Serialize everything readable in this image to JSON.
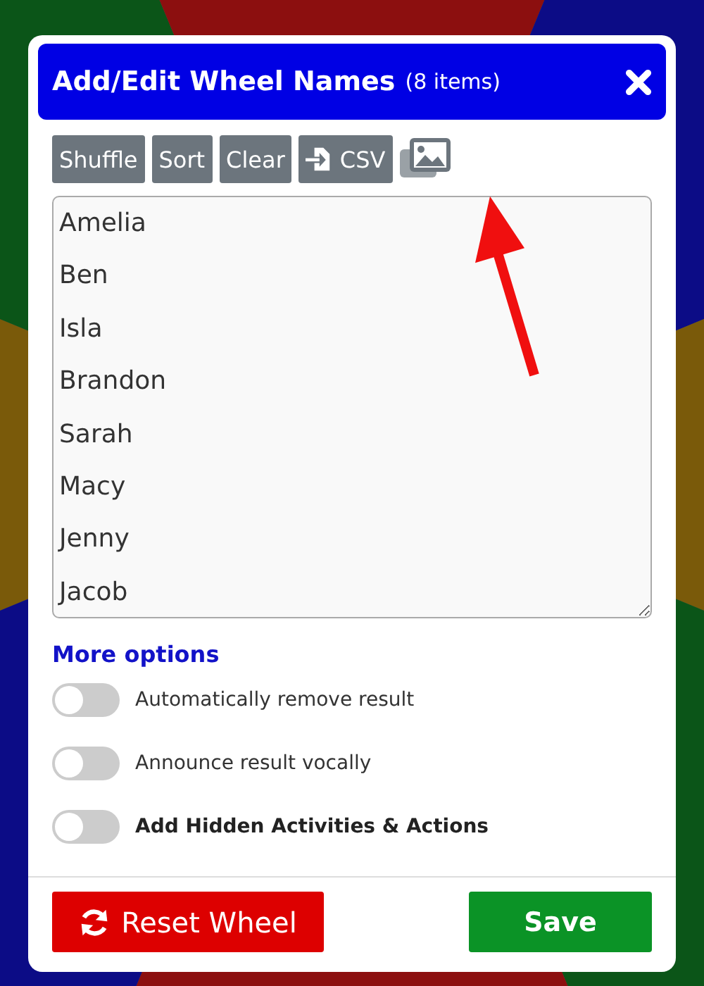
{
  "dialog": {
    "title": "Add/Edit Wheel Names",
    "count": "(8 items)"
  },
  "toolbar": [
    {
      "kind": "text",
      "label": "Shuffle"
    },
    {
      "kind": "text",
      "label": "Sort"
    },
    {
      "kind": "text",
      "label": "Clear"
    },
    {
      "kind": "import",
      "label": "CSV"
    },
    {
      "kind": "image"
    }
  ],
  "names": [
    "Amelia",
    "Ben",
    "Isla",
    "Brandon",
    "Sarah",
    "Macy",
    "Jenny",
    "Jacob"
  ],
  "more_options": "More options",
  "toggles": [
    {
      "label": "Automatically remove result",
      "on": false,
      "emphasis": false
    },
    {
      "label": "Announce result vocally",
      "on": false,
      "emphasis": false
    },
    {
      "label": "Add Hidden Activities & Actions",
      "on": false,
      "emphasis": true
    }
  ],
  "reset_button": "Reset Wheel",
  "save_button": "Save"
}
